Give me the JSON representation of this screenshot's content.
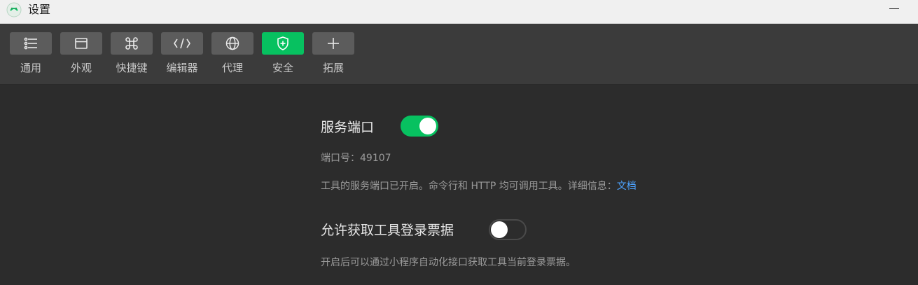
{
  "window": {
    "title": "设置"
  },
  "toolbar": {
    "items": [
      {
        "label": "通用",
        "icon": "list-sliders-icon",
        "active": false
      },
      {
        "label": "外观",
        "icon": "window-icon",
        "active": false
      },
      {
        "label": "快捷键",
        "icon": "command-key-icon",
        "active": false
      },
      {
        "label": "编辑器",
        "icon": "code-icon",
        "active": false
      },
      {
        "label": "代理",
        "icon": "globe-icon",
        "active": false
      },
      {
        "label": "安全",
        "icon": "shield-plus-icon",
        "active": true
      },
      {
        "label": "拓展",
        "icon": "plus-icon",
        "active": false
      }
    ]
  },
  "security": {
    "service_port": {
      "title": "服务端口",
      "enabled": true,
      "port_line": "端口号：49107",
      "description": "工具的服务端口已开启。命令行和 HTTP 均可调用工具。详细信息：",
      "doc_link": "文档"
    },
    "login_ticket": {
      "title": "允许获取工具登录票据",
      "enabled": false,
      "description": "开启后可以通过小程序自动化接口获取工具当前登录票据。"
    }
  },
  "colors": {
    "accent": "#07c160",
    "link": "#4da3ff"
  }
}
